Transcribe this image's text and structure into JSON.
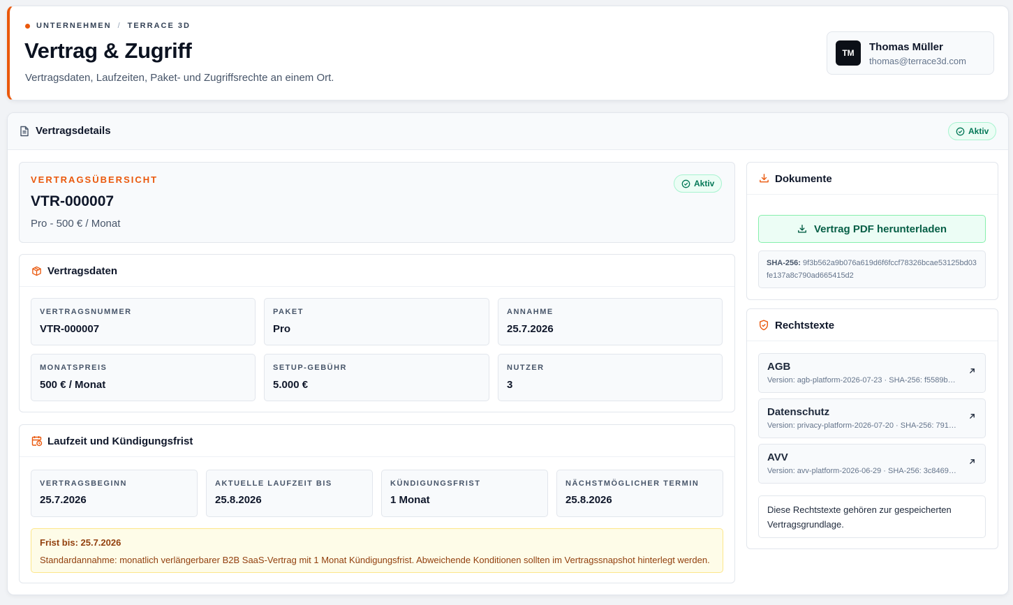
{
  "header": {
    "breadcrumb": [
      "UNTERNEHMEN",
      "TERRACE 3D"
    ],
    "breadcrumb_separator": "/",
    "title": "Vertrag & Zugriff",
    "subtitle": "Vertragsdaten, Laufzeiten, Paket- und Zugriffsrechte an einem Ort.",
    "accent_color": "#ea580c"
  },
  "user": {
    "initials": "TM",
    "name": "Thomas Müller",
    "email": "thomas@terrace3d.com"
  },
  "main": {
    "title": "Vertragsdetails",
    "title_icon": "document-icon",
    "status": "Aktiv",
    "status_icon": "check-circle-icon",
    "status_color": "#047857"
  },
  "overview": {
    "label": "VERTRAGSÜBERSICHT",
    "number": "VTR-000007",
    "plan": "Pro - 500 € / Monat",
    "status": "Aktiv"
  },
  "contract_data": {
    "title": "Vertragsdaten",
    "icon": "package-icon",
    "fields": [
      {
        "label": "VERTRAGSNUMMER",
        "value": "VTR-000007"
      },
      {
        "label": "PAKET",
        "value": "Pro"
      },
      {
        "label": "ANNAHME",
        "value": "25.7.2026"
      },
      {
        "label": "MONATSPREIS",
        "value": "500 € / Monat"
      },
      {
        "label": "SETUP-GEBÜHR",
        "value": "5.000 €"
      },
      {
        "label": "NUTZER",
        "value": "3"
      }
    ]
  },
  "term": {
    "title": "Laufzeit und Kündigungsfrist",
    "icon": "calendar-clock-icon",
    "fields": [
      {
        "label": "VERTRAGSBEGINN",
        "value": "25.7.2026"
      },
      {
        "label": "AKTUELLE LAUFZEIT BIS",
        "value": "25.8.2026"
      },
      {
        "label": "KÜNDIGUNGSFRIST",
        "value": "1 Monat"
      },
      {
        "label": "NÄCHSTMÖGLICHER TERMIN",
        "value": "25.8.2026"
      }
    ],
    "notice_title": "Frist bis: 25.7.2026",
    "notice_text": "Standardannahme: monatlich verlängerbarer B2B SaaS-Vertrag mit 1 Monat Kündigungsfrist. Abweichende Konditionen sollten im Vertragssnapshot hinterlegt werden."
  },
  "documents": {
    "title": "Dokumente",
    "icon": "download-icon",
    "download_label": "Vertrag PDF herunterladen",
    "hash_label": "SHA-256:",
    "hash_value": "9f3b562a9b076a619d6f6fccf78326bcae53125bd03fe137a8c790ad665415d2"
  },
  "legal": {
    "title": "Rechtstexte",
    "icon": "shield-icon",
    "items": [
      {
        "title": "AGB",
        "meta": "Version: agb-platform-2026-07-23 · SHA-256: f5589b…"
      },
      {
        "title": "Datenschutz",
        "meta": "Version: privacy-platform-2026-07-20 · SHA-256: 791f…"
      },
      {
        "title": "AVV",
        "meta": "Version: avv-platform-2026-06-29 · SHA-256: 3c8469…"
      }
    ],
    "item_icon": "external-link-icon",
    "note": "Diese Rechtstexte gehören zur gespeicherten Vertragsgrundlage."
  }
}
